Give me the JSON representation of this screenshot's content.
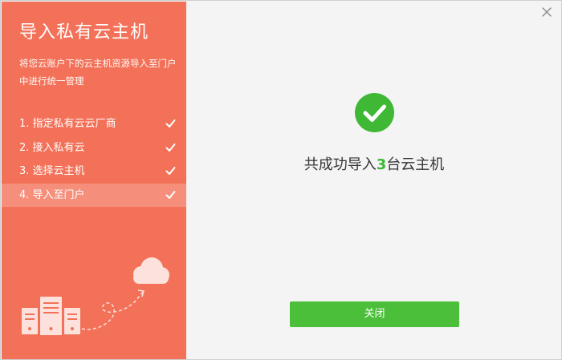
{
  "dialog": {
    "title": "导入私有云主机",
    "description": "将您云账户下的云主机资源导入至门户中进行统一管理",
    "close_icon": "close-icon"
  },
  "steps": [
    {
      "label": "1. 指定私有云云厂商",
      "completed": true,
      "active": false
    },
    {
      "label": "2. 接入私有云",
      "completed": true,
      "active": false
    },
    {
      "label": "3. 选择云主机",
      "completed": true,
      "active": false
    },
    {
      "label": "4. 导入至门户",
      "completed": true,
      "active": true
    }
  ],
  "result": {
    "icon": "success-check-icon",
    "prefix": "共成功导入",
    "count": "3",
    "suffix": "台云主机"
  },
  "actions": {
    "close_label": "关闭"
  },
  "colors": {
    "sidebar_bg": "#f37158",
    "active_step_bg": "#f58e7a",
    "success_green": "#3fb836",
    "button_green": "#4cbf3a",
    "content_bg": "#f4f4f4"
  }
}
